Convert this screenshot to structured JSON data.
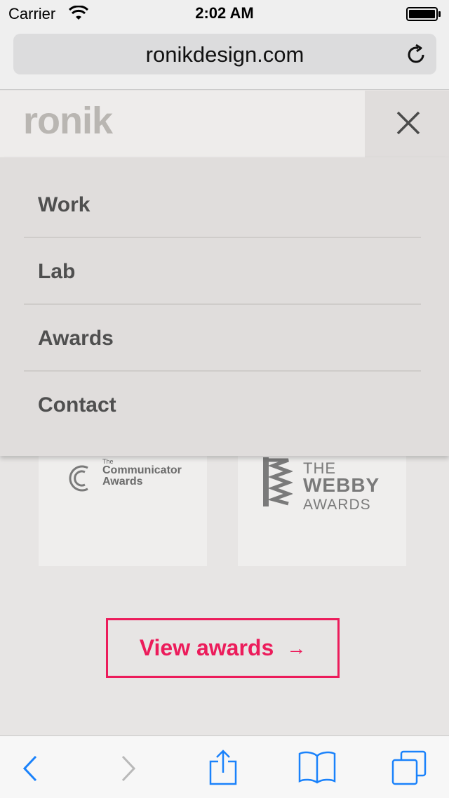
{
  "status_bar": {
    "carrier": "Carrier",
    "time": "2:02 AM",
    "icons": [
      "wifi-icon",
      "battery-icon"
    ]
  },
  "browser": {
    "url": "ronikdesign.com",
    "icons": [
      "reload-icon"
    ]
  },
  "header": {
    "logo": "ronik",
    "icons": [
      "close-icon"
    ]
  },
  "menu": {
    "items": [
      {
        "label": "Work"
      },
      {
        "label": "Lab"
      },
      {
        "label": "Awards"
      },
      {
        "label": "Contact"
      }
    ]
  },
  "awards": {
    "communicator": {
      "the": "The",
      "line1": "Communicator",
      "line2": "Awards"
    },
    "webby": {
      "the": "THE",
      "main": "WEBBY",
      "sub": "AWARDS"
    }
  },
  "cta": {
    "label": "View awards",
    "arrow": "→"
  },
  "toolbar": {
    "icons": [
      "back-icon",
      "forward-icon",
      "share-icon",
      "bookmarks-icon",
      "tabs-icon"
    ]
  },
  "colors": {
    "accent": "#ec1c5b",
    "ios_blue": "#1a82fb",
    "menu_bg": "#e0dddc",
    "page_bg": "#e7e5e4"
  }
}
